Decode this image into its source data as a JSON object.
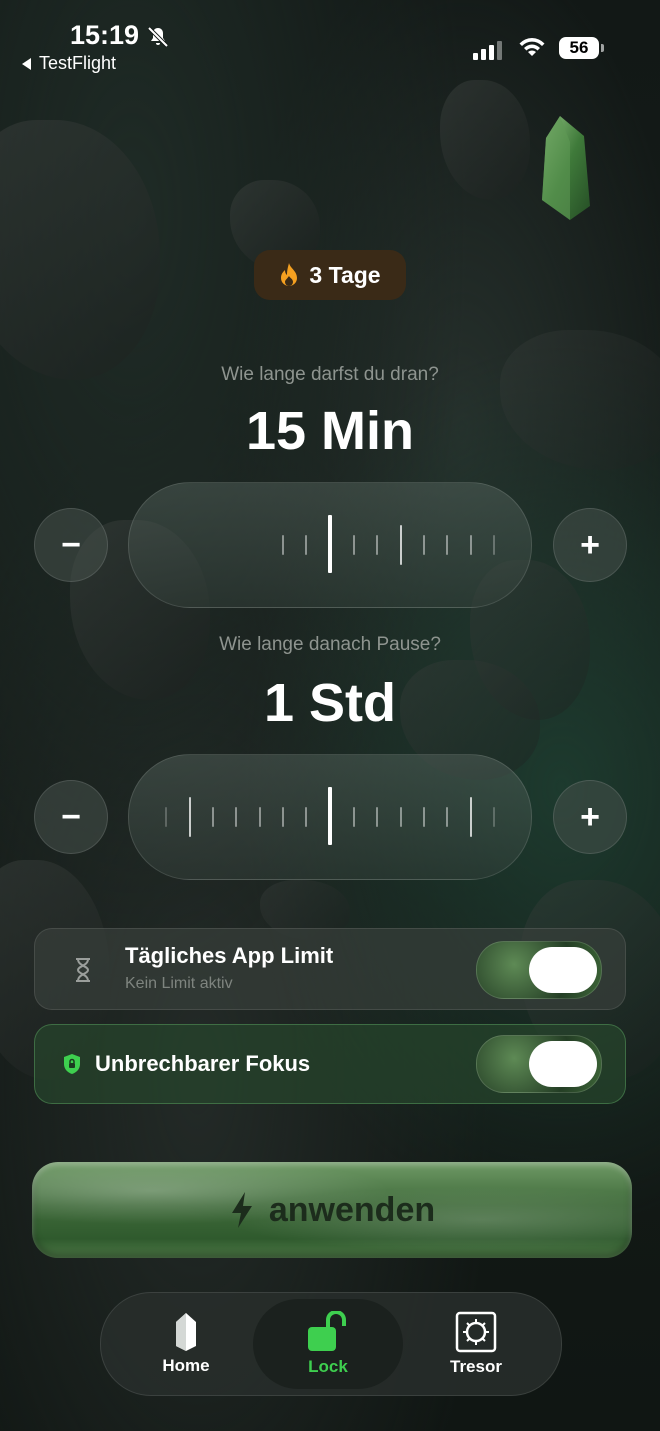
{
  "status_bar": {
    "time": "15:19",
    "back_label": "TestFlight",
    "battery": "56"
  },
  "streak": {
    "label": "3 Tage"
  },
  "usage": {
    "question": "Wie lange darfst du dran?",
    "value": "15 Min",
    "minus": "−",
    "plus": "+"
  },
  "pause": {
    "question": "Wie lange danach Pause?",
    "value": "1 Std",
    "minus": "−",
    "plus": "+"
  },
  "daily_limit": {
    "title": "Tägliches App Limit",
    "subtitle": "Kein Limit aktiv",
    "icon": "hourglass-icon",
    "enabled": true
  },
  "focus": {
    "title": "Unbrechbarer Fokus",
    "icon": "shield-lock-icon",
    "enabled": true
  },
  "apply_button": {
    "label": "anwenden",
    "icon": "lightning-icon"
  },
  "tab_bar": {
    "items": [
      {
        "label": "Home",
        "icon": "crystal-icon"
      },
      {
        "label": "Lock",
        "icon": "unlock-icon",
        "active": true
      },
      {
        "label": "Tresor",
        "icon": "safe-icon"
      }
    ]
  },
  "colors": {
    "accent": "#3ecf4f",
    "streak_bg": "#3a2a17",
    "flame": "#f5a020"
  }
}
